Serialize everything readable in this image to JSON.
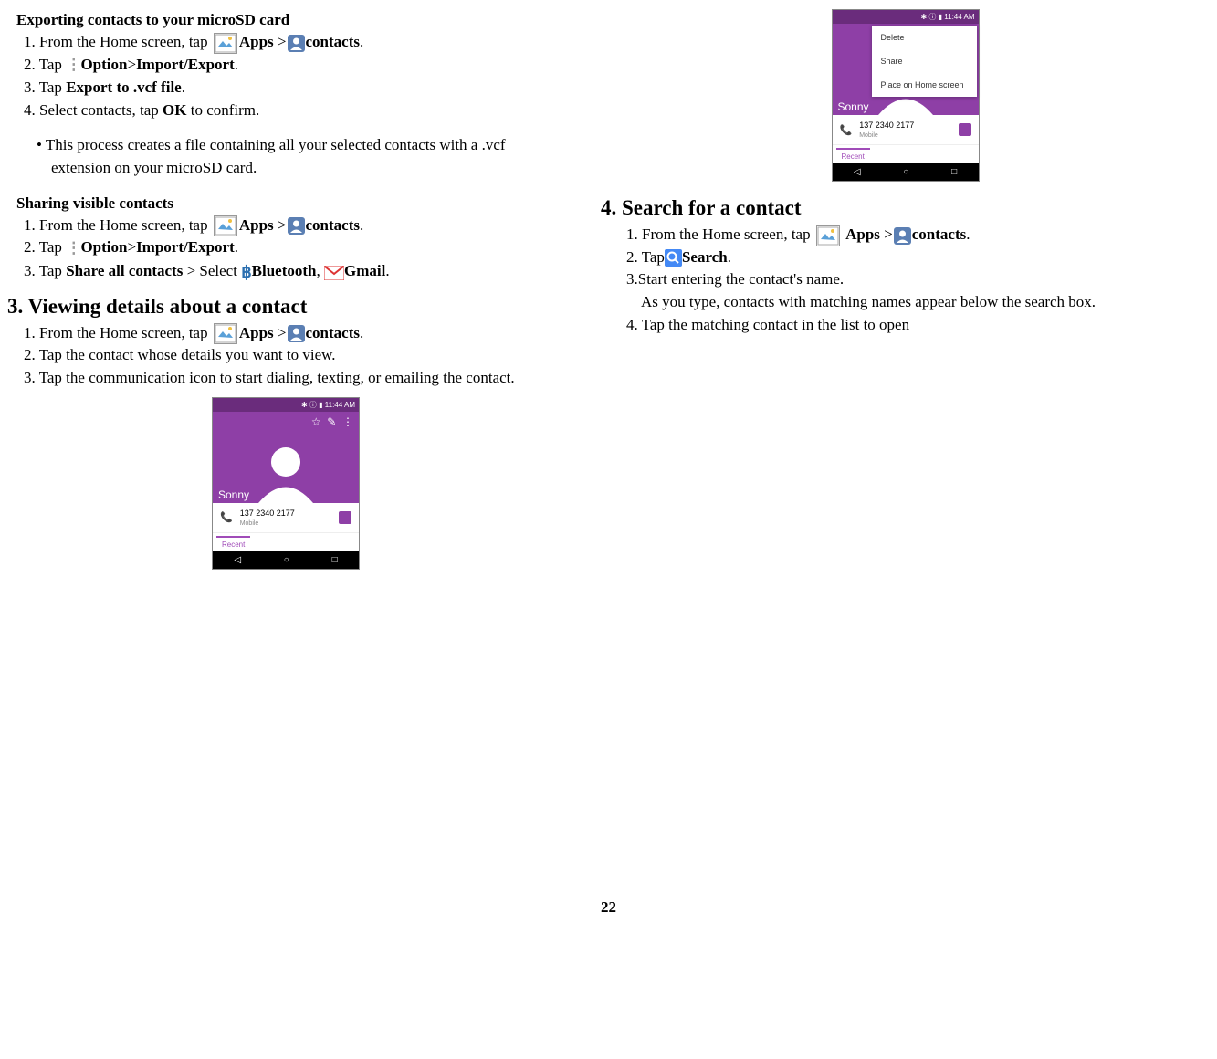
{
  "left": {
    "export_heading": "Exporting contacts to your microSD card",
    "export_step1a": "1. From the Home screen, tap  ",
    "export_step1b": "Apps",
    "export_step1c": " >",
    "export_step1d": "contacts",
    "export_step2a": "2. Tap ",
    "export_step2b": "Option",
    "export_step2c": ">",
    "export_step2d": "Import/Export",
    "export_step3a": "3. Tap ",
    "export_step3b": "Export to .vcf file",
    "export_step4a": "4. Select contacts, tap ",
    "export_step4b": "OK",
    "export_step4c": " to confirm.",
    "export_bullet": "• This process creates a file containing all your selected contacts with a .vcf extension on your microSD card.",
    "share_heading": "Sharing visible contacts",
    "share_step1a": "1. From the Home screen, tap  ",
    "share_step1b": "Apps",
    "share_step1c": " >",
    "share_step1d": "contacts",
    "share_step2a": "2. Tap ",
    "share_step2b": "Option",
    "share_step2c": ">",
    "share_step2d": "Import/Export",
    "share_step3a": "3. Tap ",
    "share_step3b": "Share all contacts",
    "share_step3c": " > Select  ",
    "share_step3d": "Bluetooth",
    "share_step3e": ",  ",
    "share_step3f": "Gmail",
    "section3_title": "3. Viewing details about a contact",
    "view_step1a": "1. From the Home screen, tap  ",
    "view_step1b": "Apps",
    "view_step1c": " >",
    "view_step1d": "contacts",
    "view_step2": "2. Tap the contact whose details you want to view.",
    "view_step3": "3. Tap the communication icon to start dialing, texting, or emailing the contact."
  },
  "right": {
    "section4_title": "4. Search for a contact",
    "search_step1a": "1. From the Home screen, tap  ",
    "search_step1b": "Apps",
    "search_step1c": " >",
    "search_step1d": "contacts",
    "search_step2a": "2. Tap",
    "search_step2b": "Search",
    "search_step3": "3.Start entering the contact's name.",
    "search_step3b": "As you type, contacts with matching names appear below the search box.",
    "search_step4": "4. Tap the matching contact in the list to open"
  },
  "phone": {
    "status_time": "11:44 AM",
    "name": "Sonny",
    "number": "137 2340 2177",
    "number_label": "Mobile",
    "recent": "Recent",
    "menu_delete": "Delete",
    "menu_share": "Share",
    "menu_place": "Place on Home screen"
  },
  "page_number": "22"
}
